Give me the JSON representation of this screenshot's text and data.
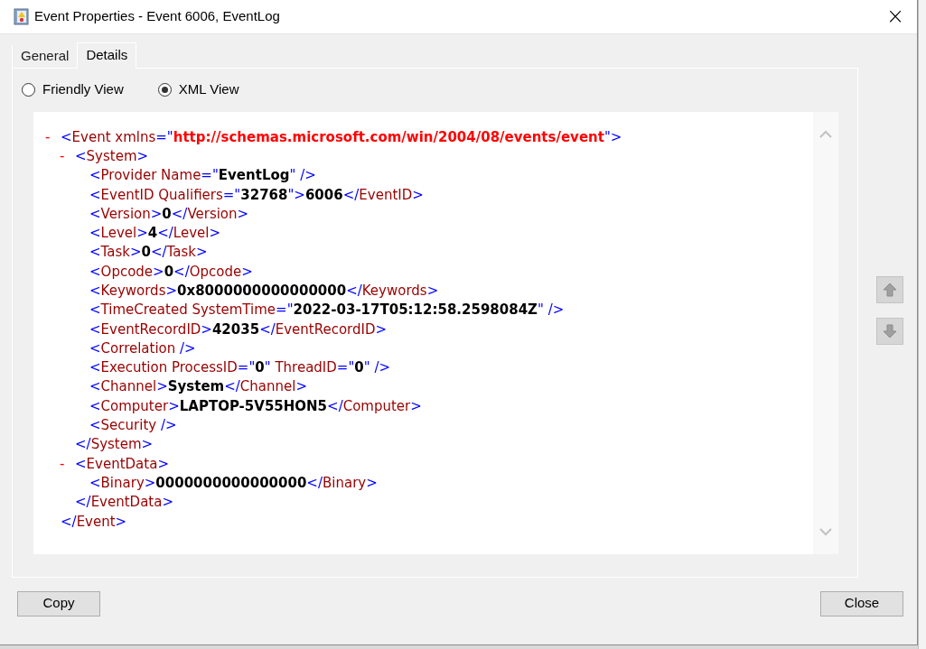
{
  "window": {
    "title": "Event Properties - Event 6006, EventLog",
    "close": "×"
  },
  "tabs": [
    {
      "label": "General",
      "selected": false
    },
    {
      "label": "Details",
      "selected": true
    }
  ],
  "view_options": [
    {
      "label": "Friendly View",
      "selected": false
    },
    {
      "label": "XML View",
      "selected": true
    }
  ],
  "xml": {
    "toggle": "-",
    "tokens": [
      {
        "kind": "mark",
        "text": "<"
      },
      {
        "kind": "name",
        "text": "Event xmlns"
      },
      {
        "kind": "mark",
        "text": "=\""
      },
      {
        "kind": "ns",
        "text": "http://schemas.microsoft.com/win/2004/08/events/event"
      },
      {
        "kind": "mark",
        "text": "\">"
      }
    ],
    "children": [
      {
        "toggle": "-",
        "tokens": [
          {
            "kind": "mark",
            "text": "<"
          },
          {
            "kind": "name",
            "text": "System"
          },
          {
            "kind": "mark",
            "text": ">"
          }
        ],
        "children": [
          {
            "tokens": [
              {
                "kind": "mark",
                "text": "<"
              },
              {
                "kind": "name",
                "text": "Provider Name"
              },
              {
                "kind": "mark",
                "text": "=\""
              },
              {
                "kind": "value",
                "text": "EventLog"
              },
              {
                "kind": "mark",
                "text": "\" />"
              }
            ]
          },
          {
            "tokens": [
              {
                "kind": "mark",
                "text": "<"
              },
              {
                "kind": "name",
                "text": "EventID Qualifiers"
              },
              {
                "kind": "mark",
                "text": "=\""
              },
              {
                "kind": "value",
                "text": "32768"
              },
              {
                "kind": "mark",
                "text": "\">"
              },
              {
                "kind": "value",
                "text": "6006"
              },
              {
                "kind": "mark",
                "text": "</"
              },
              {
                "kind": "name",
                "text": "EventID"
              },
              {
                "kind": "mark",
                "text": ">"
              }
            ]
          },
          {
            "tokens": [
              {
                "kind": "mark",
                "text": "<"
              },
              {
                "kind": "name",
                "text": "Version"
              },
              {
                "kind": "mark",
                "text": ">"
              },
              {
                "kind": "value",
                "text": "0"
              },
              {
                "kind": "mark",
                "text": "</"
              },
              {
                "kind": "name",
                "text": "Version"
              },
              {
                "kind": "mark",
                "text": ">"
              }
            ]
          },
          {
            "tokens": [
              {
                "kind": "mark",
                "text": "<"
              },
              {
                "kind": "name",
                "text": "Level"
              },
              {
                "kind": "mark",
                "text": ">"
              },
              {
                "kind": "value",
                "text": "4"
              },
              {
                "kind": "mark",
                "text": "</"
              },
              {
                "kind": "name",
                "text": "Level"
              },
              {
                "kind": "mark",
                "text": ">"
              }
            ]
          },
          {
            "tokens": [
              {
                "kind": "mark",
                "text": "<"
              },
              {
                "kind": "name",
                "text": "Task"
              },
              {
                "kind": "mark",
                "text": ">"
              },
              {
                "kind": "value",
                "text": "0"
              },
              {
                "kind": "mark",
                "text": "</"
              },
              {
                "kind": "name",
                "text": "Task"
              },
              {
                "kind": "mark",
                "text": ">"
              }
            ]
          },
          {
            "tokens": [
              {
                "kind": "mark",
                "text": "<"
              },
              {
                "kind": "name",
                "text": "Opcode"
              },
              {
                "kind": "mark",
                "text": ">"
              },
              {
                "kind": "value",
                "text": "0"
              },
              {
                "kind": "mark",
                "text": "</"
              },
              {
                "kind": "name",
                "text": "Opcode"
              },
              {
                "kind": "mark",
                "text": ">"
              }
            ]
          },
          {
            "tokens": [
              {
                "kind": "mark",
                "text": "<"
              },
              {
                "kind": "name",
                "text": "Keywords"
              },
              {
                "kind": "mark",
                "text": ">"
              },
              {
                "kind": "value",
                "text": "0x8000000000000000"
              },
              {
                "kind": "mark",
                "text": "</"
              },
              {
                "kind": "name",
                "text": "Keywords"
              },
              {
                "kind": "mark",
                "text": ">"
              }
            ]
          },
          {
            "tokens": [
              {
                "kind": "mark",
                "text": "<"
              },
              {
                "kind": "name",
                "text": "TimeCreated SystemTime"
              },
              {
                "kind": "mark",
                "text": "=\""
              },
              {
                "kind": "value",
                "text": "2022-03-17T05:12:58.2598084Z"
              },
              {
                "kind": "mark",
                "text": "\" />"
              }
            ]
          },
          {
            "tokens": [
              {
                "kind": "mark",
                "text": "<"
              },
              {
                "kind": "name",
                "text": "EventRecordID"
              },
              {
                "kind": "mark",
                "text": ">"
              },
              {
                "kind": "value",
                "text": "42035"
              },
              {
                "kind": "mark",
                "text": "</"
              },
              {
                "kind": "name",
                "text": "EventRecordID"
              },
              {
                "kind": "mark",
                "text": ">"
              }
            ]
          },
          {
            "tokens": [
              {
                "kind": "mark",
                "text": "<"
              },
              {
                "kind": "name",
                "text": "Correlation"
              },
              {
                "kind": "mark",
                "text": " />"
              }
            ]
          },
          {
            "tokens": [
              {
                "kind": "mark",
                "text": "<"
              },
              {
                "kind": "name",
                "text": "Execution ProcessID"
              },
              {
                "kind": "mark",
                "text": "=\""
              },
              {
                "kind": "value",
                "text": "0"
              },
              {
                "kind": "mark",
                "text": "\""
              },
              {
                "kind": "name",
                "text": " ThreadID"
              },
              {
                "kind": "mark",
                "text": "=\""
              },
              {
                "kind": "value",
                "text": "0"
              },
              {
                "kind": "mark",
                "text": "\" />"
              }
            ]
          },
          {
            "tokens": [
              {
                "kind": "mark",
                "text": "<"
              },
              {
                "kind": "name",
                "text": "Channel"
              },
              {
                "kind": "mark",
                "text": ">"
              },
              {
                "kind": "value",
                "text": "System"
              },
              {
                "kind": "mark",
                "text": "</"
              },
              {
                "kind": "name",
                "text": "Channel"
              },
              {
                "kind": "mark",
                "text": ">"
              }
            ]
          },
          {
            "tokens": [
              {
                "kind": "mark",
                "text": "<"
              },
              {
                "kind": "name",
                "text": "Computer"
              },
              {
                "kind": "mark",
                "text": ">"
              },
              {
                "kind": "value",
                "text": "LAPTOP-5V55HON5"
              },
              {
                "kind": "mark",
                "text": "</"
              },
              {
                "kind": "name",
                "text": "Computer"
              },
              {
                "kind": "mark",
                "text": ">"
              }
            ]
          },
          {
            "tokens": [
              {
                "kind": "mark",
                "text": "<"
              },
              {
                "kind": "name",
                "text": "Security"
              },
              {
                "kind": "mark",
                "text": " />"
              }
            ]
          }
        ],
        "closing": [
          {
            "kind": "mark",
            "text": "</"
          },
          {
            "kind": "name",
            "text": "System"
          },
          {
            "kind": "mark",
            "text": ">"
          }
        ]
      },
      {
        "toggle": "-",
        "tokens": [
          {
            "kind": "mark",
            "text": "<"
          },
          {
            "kind": "name",
            "text": "EventData"
          },
          {
            "kind": "mark",
            "text": ">"
          }
        ],
        "children": [
          {
            "tokens": [
              {
                "kind": "mark",
                "text": "<"
              },
              {
                "kind": "name",
                "text": "Binary"
              },
              {
                "kind": "mark",
                "text": ">"
              },
              {
                "kind": "value",
                "text": "0000000000000000"
              },
              {
                "kind": "mark",
                "text": "</"
              },
              {
                "kind": "name",
                "text": "Binary"
              },
              {
                "kind": "mark",
                "text": ">"
              }
            ]
          }
        ],
        "closing": [
          {
            "kind": "mark",
            "text": "</"
          },
          {
            "kind": "name",
            "text": "EventData"
          },
          {
            "kind": "mark",
            "text": ">"
          }
        ]
      }
    ],
    "closing": [
      {
        "kind": "mark",
        "text": "</"
      },
      {
        "kind": "name",
        "text": "Event"
      },
      {
        "kind": "mark",
        "text": ">"
      }
    ]
  },
  "buttons": [
    {
      "label": "Copy"
    },
    {
      "label": "Close"
    }
  ]
}
